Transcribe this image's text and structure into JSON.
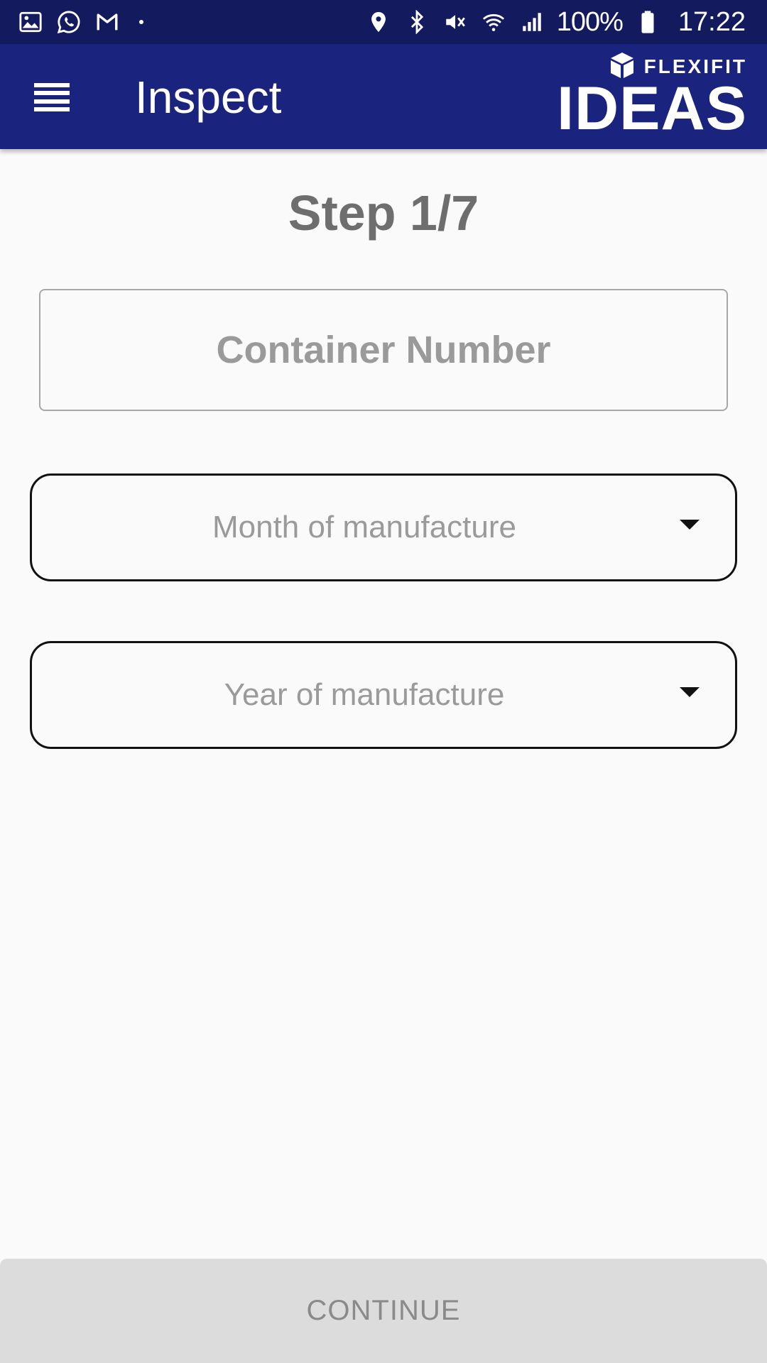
{
  "status_bar": {
    "left_icons": [
      "gallery-icon",
      "whatsapp-icon",
      "gmail-icon",
      "dot-icon"
    ],
    "right_icons": [
      "location-icon",
      "bluetooth-icon",
      "mute-vibrate-icon",
      "wifi-icon",
      "signal-icon",
      "battery-icon"
    ],
    "battery": "100%",
    "time": "17:22"
  },
  "app_bar": {
    "title": "Inspect",
    "menu_icon": "menu-icon",
    "logo": {
      "small": "FLEXIFIT",
      "big": "IDEAS"
    }
  },
  "main": {
    "step": "Step 1/7",
    "container_number": {
      "value": "",
      "placeholder": "Container Number"
    },
    "month_select": {
      "placeholder": "Month of manufacture",
      "icon": "caret-down-icon"
    },
    "year_select": {
      "placeholder": "Year of manufacture",
      "icon": "caret-down-icon"
    }
  },
  "footer": {
    "continue_label": "CONTINUE"
  },
  "colors": {
    "status_bar": "#131a5e",
    "app_bar": "#1a237e",
    "background": "#fafafa",
    "button_disabled": "#dcdcdc",
    "muted_text": "#9a9a9a"
  }
}
